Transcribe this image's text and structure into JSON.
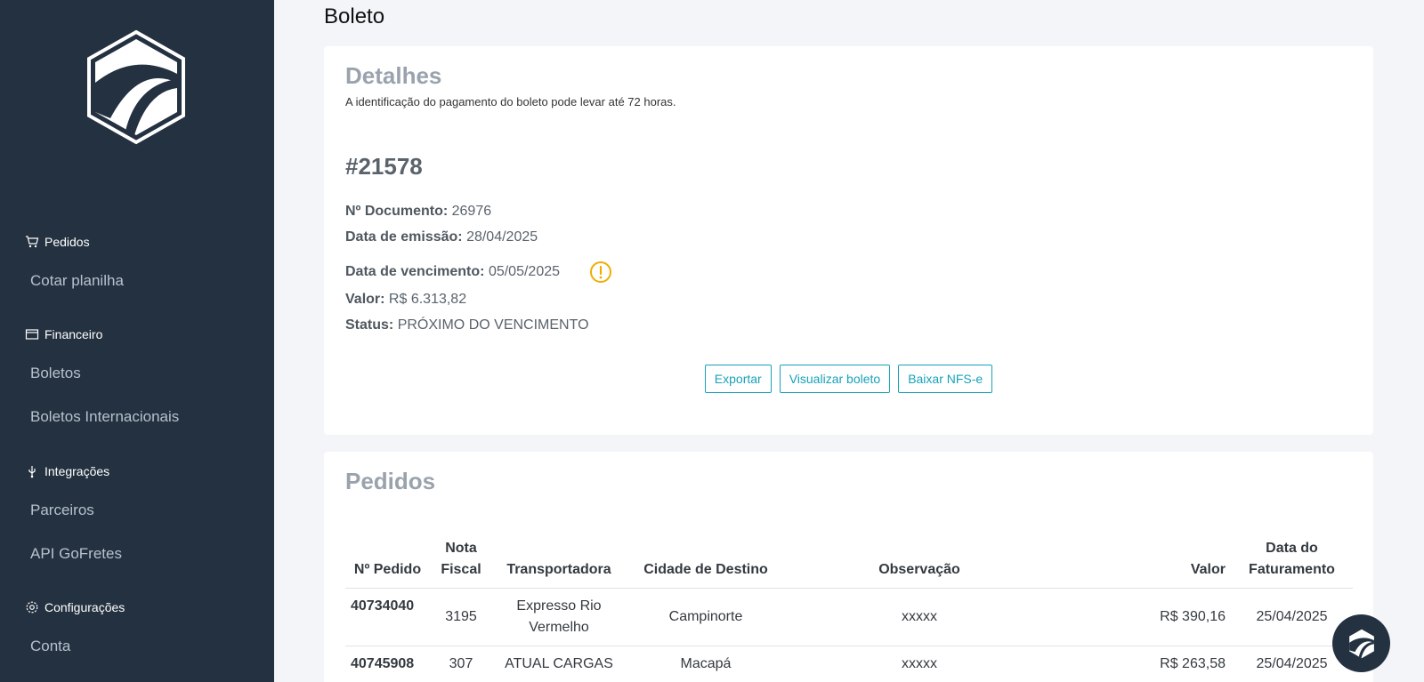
{
  "sidebar": {
    "groups": [
      {
        "label": "Pedidos",
        "icon": "cart-icon",
        "items": [
          "Cotar planilha"
        ]
      },
      {
        "label": "Financeiro",
        "icon": "wallet-icon",
        "items": [
          "Boletos",
          "Boletos Internacionais"
        ]
      },
      {
        "label": "Integrações",
        "icon": "usb-icon",
        "items": [
          "Parceiros",
          "API GoFretes"
        ]
      },
      {
        "label": "Configurações",
        "icon": "gear-icon",
        "items": [
          "Conta"
        ]
      }
    ]
  },
  "page": {
    "title": "Boleto"
  },
  "details": {
    "title": "Detalhes",
    "subtitle": "A identificação do pagamento do boleto pode levar até 72 horas.",
    "number": "#21578",
    "doc_label": "Nº Documento:",
    "doc_value": "26976",
    "emissao_label": "Data de emissão:",
    "emissao_value": "28/04/2025",
    "vencimento_label": "Data de vencimento:",
    "vencimento_value": "05/05/2025",
    "valor_label": "Valor:",
    "valor_value": "R$ 6.313,82",
    "status_label": "Status:",
    "status_value": "PRÓXIMO DO VENCIMENTO",
    "buttons": {
      "export": "Exportar",
      "view": "Visualizar boleto",
      "download": "Baixar NFS-e"
    },
    "warning_color": "#f0ad00"
  },
  "orders": {
    "title": "Pedidos",
    "headers": [
      "Nº Pedido",
      "Nota Fiscal",
      "Transportadora",
      "Cidade de Destino",
      "Observação",
      "Valor",
      "Data do Faturamento"
    ],
    "rows": [
      [
        "40734040",
        "3195",
        "Expresso Rio Vermelho",
        "Campinorte",
        "xxxxx",
        "R$ 390,16",
        "25/04/2025"
      ],
      [
        "40745908",
        "307",
        "ATUAL CARGAS",
        "Macapá",
        "xxxxx",
        "R$ 263,58",
        "25/04/2025"
      ]
    ]
  },
  "colors": {
    "sidebar": "#233140",
    "accent": "#17a2b8"
  }
}
